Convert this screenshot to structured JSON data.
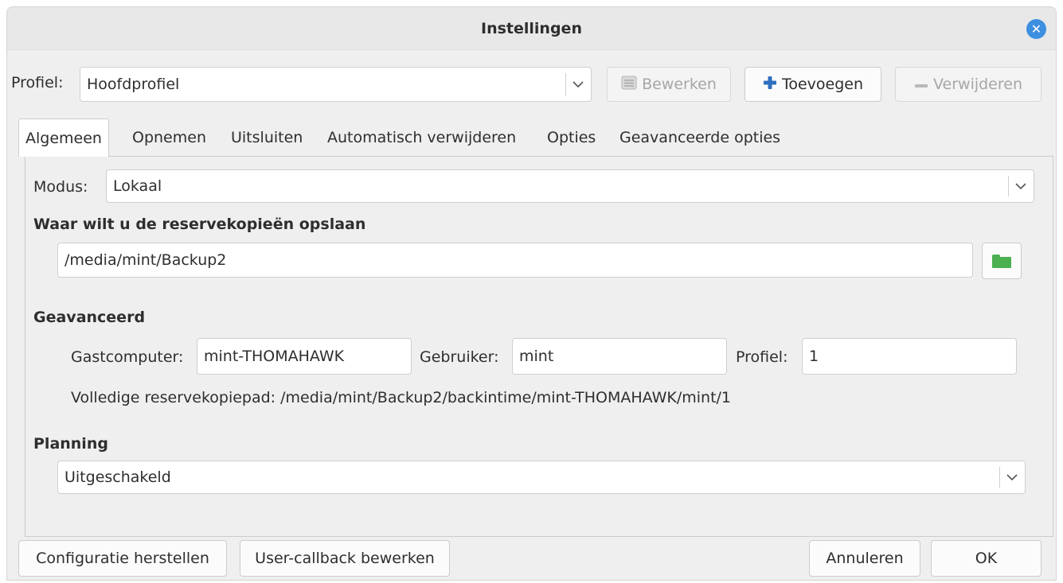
{
  "window": {
    "title": "Instellingen"
  },
  "profile": {
    "label": "Profiel:",
    "selected": "Hoofdprofiel",
    "edit_label": "Bewerken",
    "add_label": "Toevoegen",
    "remove_label": "Verwijderen"
  },
  "tabs": [
    {
      "label": "Algemeen",
      "active": true
    },
    {
      "label": "Opnemen",
      "active": false
    },
    {
      "label": "Uitsluiten",
      "active": false
    },
    {
      "label": "Automatisch verwijderen",
      "active": false
    },
    {
      "label": "Opties",
      "active": false
    },
    {
      "label": "Geavanceerde opties",
      "active": false
    }
  ],
  "general": {
    "mode_label": "Modus:",
    "mode_value": "Lokaal",
    "where_heading": "Waar wilt u de reservekopieën opslaan",
    "path_value": "/media/mint/Backup2",
    "advanced_heading": "Geavanceerd",
    "host_label": "Gastcomputer:",
    "host_value": "mint-THOMAHAWK",
    "user_label": "Gebruiker:",
    "user_value": "mint",
    "profile_label": "Profiel:",
    "profile_value": "1",
    "full_path_text": "Volledige reservekopiepad: /media/mint/Backup2/backintime/mint-THOMAHAWK/mint/1",
    "schedule_heading": "Planning",
    "schedule_value": "Uitgeschakeld"
  },
  "footer": {
    "restore_label": "Configuratie herstellen",
    "callback_label": "User-callback bewerken",
    "cancel_label": "Annuleren",
    "ok_label": "OK"
  },
  "colors": {
    "accent": "#3d8fe0",
    "folder_icon": "#4caf50",
    "add_icon": "#2f6fbf"
  }
}
